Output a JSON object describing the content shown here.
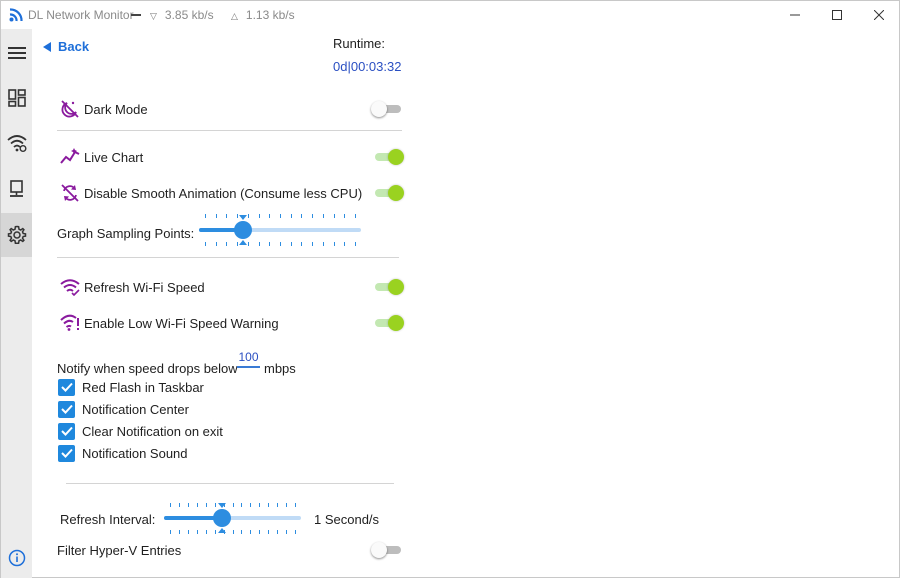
{
  "app": {
    "title": "DL Network Monitor",
    "download_speed": "3.85 kb/s",
    "upload_speed": "1.13 kb/s"
  },
  "nav": {
    "back_label": "Back"
  },
  "runtime": {
    "label": "Runtime:",
    "value": "0d|00:03:32"
  },
  "settings": {
    "dark_mode": {
      "label": "Dark Mode",
      "enabled": false
    },
    "live_chart": {
      "label": "Live Chart",
      "enabled": true
    },
    "smooth_animation": {
      "label": "Disable Smooth Animation (Consume less CPU)",
      "enabled": true
    },
    "graph_sampling": {
      "label": "Graph Sampling Points:",
      "position_fraction": 0.27
    },
    "refresh_wifi": {
      "label": "Refresh Wi-Fi Speed",
      "enabled": true
    },
    "low_wifi_warning": {
      "label": "Enable Low Wi-Fi Speed Warning",
      "enabled": true
    },
    "notify": {
      "prefix": "Notify when speed drops below",
      "threshold": "100",
      "unit": "mbps"
    },
    "checkboxes": [
      {
        "label": "Red Flash in Taskbar",
        "checked": true
      },
      {
        "label": "Notification Center",
        "checked": true
      },
      {
        "label": "Clear Notification on exit",
        "checked": true
      },
      {
        "label": "Notification Sound",
        "checked": true
      }
    ],
    "refresh_interval": {
      "label": "Refresh Interval:",
      "value": "1 Second/s",
      "position_fraction": 0.42
    },
    "hyperv": {
      "label": "Filter Hyper-V Entries",
      "enabled": false
    }
  },
  "colors": {
    "accent_blue": "#2d8de0",
    "toggle_on": "#9ad220",
    "icon_purple": "#8a1a9e"
  }
}
